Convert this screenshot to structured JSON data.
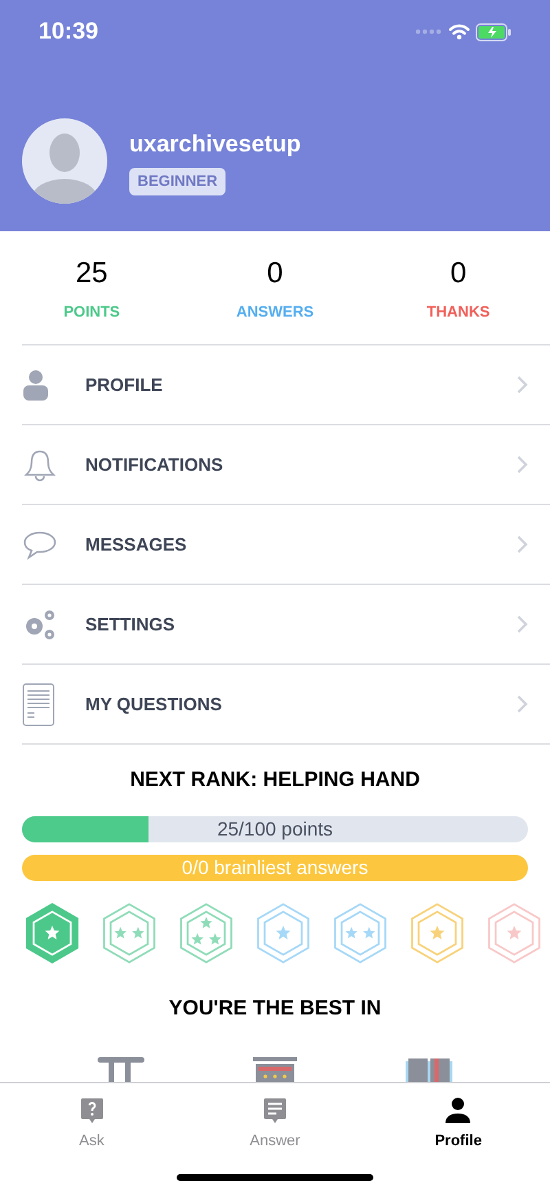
{
  "status_bar": {
    "time": "10:39"
  },
  "profile": {
    "username": "uxarchivesetup",
    "rank": "BEGINNER"
  },
  "stats": [
    {
      "value": "25",
      "label": "POINTS",
      "color": "#4cc98a"
    },
    {
      "value": "0",
      "label": "ANSWERS",
      "color": "#55aef0"
    },
    {
      "value": "0",
      "label": "THANKS",
      "color": "#f0605a"
    }
  ],
  "menu": [
    {
      "label": "PROFILE"
    },
    {
      "label": "NOTIFICATIONS"
    },
    {
      "label": "MESSAGES"
    },
    {
      "label": "SETTINGS"
    },
    {
      "label": "MY QUESTIONS"
    }
  ],
  "next_rank": {
    "title": "NEXT RANK: HELPING HAND",
    "points": {
      "text": "25/100 points",
      "level": 0.25
    },
    "brainliest": {
      "text": "0/0 brainliest answers"
    }
  },
  "badges": [
    {
      "color": "#4cc98a",
      "kind": "single",
      "earned": true
    },
    {
      "color": "#8fdcb8",
      "kind": "double",
      "earned": false
    },
    {
      "color": "#8fdcb8",
      "kind": "triple",
      "earned": false
    },
    {
      "color": "#a6d8f7",
      "kind": "single",
      "earned": false
    },
    {
      "color": "#a6d8f7",
      "kind": "double",
      "earned": false
    },
    {
      "color": "#f8d27a",
      "kind": "single",
      "earned": false
    },
    {
      "color": "#f8c8c8",
      "kind": "single",
      "earned": false
    }
  ],
  "best_in": {
    "title": "YOU'RE THE BEST IN"
  },
  "tab_bar": [
    {
      "label": "Ask",
      "selected": false
    },
    {
      "label": "Answer",
      "selected": false
    },
    {
      "label": "Profile",
      "selected": true
    }
  ]
}
